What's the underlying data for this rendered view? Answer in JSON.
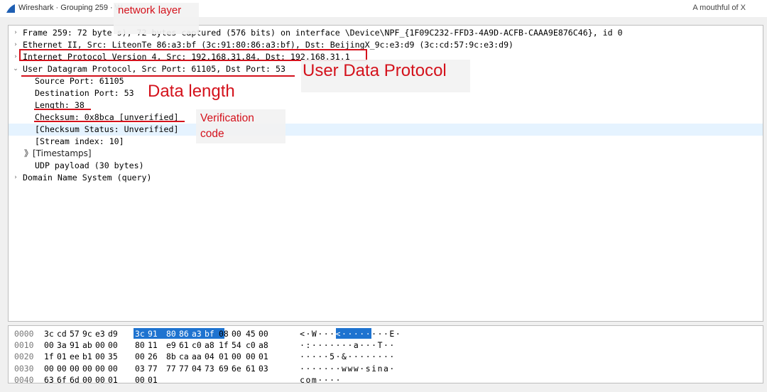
{
  "window": {
    "title": "Wireshark · Grouping 259 · W...",
    "right_label": "A mouthful of X"
  },
  "tree": [
    {
      "arrow": "›",
      "text": "Frame 259: 72 byte                   s), 72 bytes captured (576 bits) on interface \\Device\\NPF_{1F09C232-FFD3-4A9D-ACFB-CAAA9E876C46}, id 0"
    },
    {
      "arrow": "›",
      "text": "Ethernet II, Src: LiteonTe_86:a3:bf (3c:91:80:86:a3:bf), Dst: BeijingX_9c:e3:d9 (3c:cd:57:9c:e3:d9)"
    },
    {
      "arrow": "›",
      "text": "Internet Protocol Version 4, Src: 192.168.31.84, Dst: 192.168.31.1"
    },
    {
      "arrow": "⌄",
      "text": "User Datagram Protocol, Src Port: 61105, Dst Port: 53"
    },
    {
      "arrow": "",
      "text": "Source Port: 61105"
    },
    {
      "arrow": "",
      "text": "Destination Port: 53"
    },
    {
      "arrow": "",
      "text": "Length: 38"
    },
    {
      "arrow": "",
      "text": "Checksum: 0x8bca [unverified]"
    },
    {
      "arrow": "",
      "text": "[Checksum Status: Unverified]"
    },
    {
      "arrow": "",
      "text": "[Stream index: 10]"
    },
    {
      "arrow": "",
      "text": "》[Timestamps]"
    },
    {
      "arrow": "",
      "text": "UDP payload (30 bytes)"
    },
    {
      "arrow": "›",
      "text": "Domain Name System (query)"
    }
  ],
  "hex": [
    {
      "offset": "0000",
      "bytes": [
        "3c",
        "cd",
        "57",
        "9c",
        "e3",
        "d9",
        "3c",
        "91",
        "80",
        "86",
        "a3",
        "bf",
        "08",
        "00",
        "45",
        "00"
      ],
      "ascii": [
        "<",
        "·",
        "W",
        "·",
        "·",
        "·",
        "<",
        "·",
        "·",
        "·",
        "·",
        "·",
        "·",
        "·",
        "·",
        "E",
        "·"
      ]
    },
    {
      "offset": "0010",
      "bytes": [
        "00",
        "3a",
        "91",
        "ab",
        "00",
        "00",
        "80",
        "11",
        "e9",
        "61",
        "c0",
        "a8",
        "1f",
        "54",
        "c0",
        "a8"
      ],
      "ascii": [
        "·",
        ":",
        "·",
        "·",
        "·",
        "·",
        "·",
        "·",
        "·",
        "a",
        "·",
        "·",
        "·",
        "T",
        "·",
        "·"
      ]
    },
    {
      "offset": "0020",
      "bytes": [
        "1f",
        "01",
        "ee",
        "b1",
        "00",
        "35",
        "00",
        "26",
        "8b",
        "ca",
        "aa",
        "04",
        "01",
        "00",
        "00",
        "01"
      ],
      "ascii": [
        "·",
        "·",
        "·",
        "·",
        "·",
        "5",
        "·",
        "&",
        "·",
        "·",
        "·",
        "·",
        "·",
        "·",
        "·",
        "·"
      ]
    },
    {
      "offset": "0030",
      "bytes": [
        "00",
        "00",
        "00",
        "00",
        "00",
        "00",
        "03",
        "77",
        "77",
        "77",
        "04",
        "73",
        "69",
        "6e",
        "61",
        "03"
      ],
      "ascii": [
        "·",
        "·",
        "·",
        "·",
        "·",
        "·",
        "·",
        "w",
        "w",
        "w",
        "·",
        "s",
        "i",
        "n",
        "a",
        "·"
      ]
    },
    {
      "offset": "0040",
      "bytes": [
        "63",
        "6f",
        "6d",
        "00",
        "00",
        "01",
        "00",
        "01"
      ],
      "ascii": [
        "c",
        "o",
        "m",
        "·",
        "·",
        "·",
        "·"
      ]
    }
  ],
  "annotations": {
    "network_layer": "network layer",
    "user_data_protocol": "User Data Protocol",
    "data_length": "Data length",
    "verification_line1": "Verification",
    "verification_line2": "code"
  },
  "colors": {
    "annotation": "#d4121c",
    "selection": "#1e73d0",
    "row_highlight": "#e5f3ff"
  }
}
